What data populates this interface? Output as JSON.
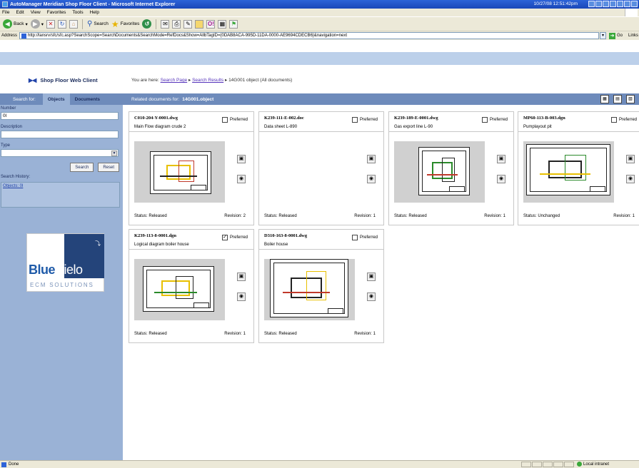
{
  "window": {
    "title": "AutoManager Meridian Shop Floor Client - Microsoft Internet Explorer",
    "clock": "10/27/08 12:51:42pm"
  },
  "menu": [
    "File",
    "Edit",
    "View",
    "Favorites",
    "Tools",
    "Help"
  ],
  "toolbar": {
    "back": "Back",
    "search": "Search",
    "favorites": "Favorites"
  },
  "address": {
    "label": "Address",
    "url": "http://lansrv/sfc/sfc.asp?SearchScope=SearchDocuments&SearchMode=RefDocs&Show=AllbTagID={0DAB8ACA-995D-11DA-0000-AE9694CDECB6}&navigation=next",
    "go": "Go",
    "links": "Links"
  },
  "header": {
    "app_title": "Shop Floor Web Client",
    "crumbs_prefix": "You are here:",
    "crumb_1": "Search Page",
    "crumb_2": "Search Results",
    "crumb_3": "14G001 object",
    "crumb_3_suffix": "(All documents)"
  },
  "sidebar": {
    "search_for": "Search for:",
    "tab_objects": "Objects",
    "tab_documents": "Documents",
    "number_label": "Number",
    "number_value": "0l",
    "description_label": "Description",
    "description_value": "",
    "type_label": "Type",
    "type_value": "",
    "search_button": "Search",
    "reset_button": "Reset",
    "history_label": "Search History:",
    "history_item": "Objects: 0l"
  },
  "branding": {
    "blue": "Blue",
    "cielo": "Cielo",
    "sub": "ECM SOLUTIONS"
  },
  "main": {
    "related_prefix": "Related documents for:",
    "related_object": "14G001.object"
  },
  "documents": [
    {
      "file": "C010-204-Y-0001.dwg",
      "desc": "Main Flow diagram crude 2",
      "preferred_label": "Preferred",
      "preferred": false,
      "status_label": "Status:",
      "status": "Released",
      "revision_label": "Revision:",
      "revision": "2",
      "thumb": "drawing"
    },
    {
      "file": "K239-111-E-002.doc",
      "desc": "Data sheet L-890",
      "preferred_label": "Preferred",
      "preferred": false,
      "status_label": "Status:",
      "status": "Released",
      "revision_label": "Revision:",
      "revision": "1",
      "thumb": "blank"
    },
    {
      "file": "K239-189-E-0001.dwg",
      "desc": "Gas export line L-90",
      "preferred_label": "Preferred",
      "preferred": false,
      "status_label": "Status:",
      "status": "Released",
      "revision_label": "Revision:",
      "revision": "1",
      "thumb": "drawing"
    },
    {
      "file": "MP60-113-B-003.dgn",
      "desc": "Pumplayout pit",
      "preferred_label": "Preferred",
      "preferred": false,
      "status_label": "Status:",
      "status": "Unchanged",
      "revision_label": "Revision:",
      "revision": "1",
      "thumb": "drawing"
    },
    {
      "file": "K239-113-8-0001.dgn",
      "desc": "Logical diagram boiler house",
      "preferred_label": "Preferred",
      "preferred": true,
      "status_label": "Status:",
      "status": "Released",
      "revision_label": "Revision:",
      "revision": "1",
      "thumb": "drawing"
    },
    {
      "file": "D310-163-8-0001.dwg",
      "desc": "Boiler house",
      "preferred_label": "Preferred",
      "preferred": false,
      "status_label": "Status:",
      "status": "Released",
      "revision_label": "Revision:",
      "revision": "1",
      "thumb": "drawing"
    }
  ],
  "statusbar": {
    "text": "Done",
    "zone": "Local intranet"
  }
}
